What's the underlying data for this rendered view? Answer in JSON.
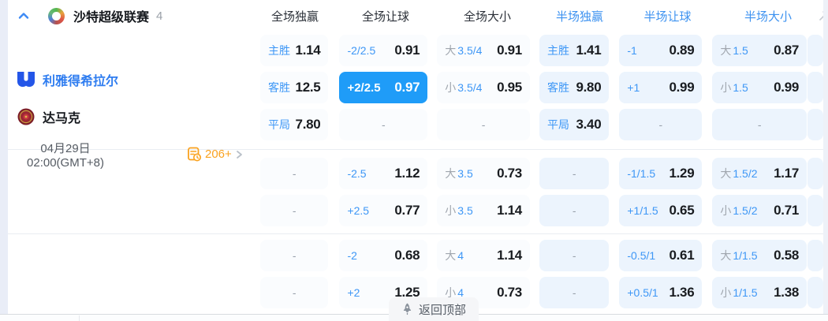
{
  "header": {
    "league_name": "沙特超级联赛",
    "league_count": "4",
    "columns": [
      {
        "label": "全场独赢",
        "half": false
      },
      {
        "label": "全场让球",
        "half": false
      },
      {
        "label": "全场大小",
        "half": false
      },
      {
        "label": "半场独赢",
        "half": true
      },
      {
        "label": "半场让球",
        "half": true
      },
      {
        "label": "半场大小",
        "half": true
      }
    ]
  },
  "match": {
    "home_name": "利雅得希拉尔",
    "away_name": "达马克",
    "date_line1": "04月29日",
    "date_line2": "02:00(GMT+8)",
    "stats_count": "206+"
  },
  "odds": {
    "groups": [
      [
        [
          {
            "line": "主胜",
            "value": "1.14"
          },
          {
            "line": "-2/2.5",
            "value": "0.91"
          },
          {
            "prefix": "大",
            "line": "3.5/4",
            "value": "0.91"
          },
          {
            "line": "主胜",
            "value": "1.41"
          },
          {
            "line": "-1",
            "value": "0.89"
          },
          {
            "prefix": "大",
            "line": "1.5",
            "value": "0.87"
          }
        ],
        [
          {
            "line": "客胜",
            "value": "12.5"
          },
          {
            "line": "+2/2.5",
            "value": "0.97",
            "highlight": true
          },
          {
            "prefix": "小",
            "line": "3.5/4",
            "value": "0.95"
          },
          {
            "line": "客胜",
            "value": "9.80"
          },
          {
            "line": "+1",
            "value": "0.99"
          },
          {
            "prefix": "小",
            "line": "1.5",
            "value": "0.99"
          }
        ],
        [
          {
            "line": "平局",
            "value": "7.80"
          },
          {
            "dash": true
          },
          {
            "dash": true
          },
          {
            "line": "平局",
            "value": "3.40"
          },
          {
            "dash": true
          },
          {
            "dash": true
          }
        ]
      ],
      [
        [
          {
            "dash": true
          },
          {
            "line": "-2.5",
            "value": "1.12"
          },
          {
            "prefix": "大",
            "line": "3.5",
            "value": "0.73"
          },
          {
            "dash": true
          },
          {
            "line": "-1/1.5",
            "value": "1.29"
          },
          {
            "prefix": "大",
            "line": "1.5/2",
            "value": "1.17"
          }
        ],
        [
          {
            "dash": true
          },
          {
            "line": "+2.5",
            "value": "0.77"
          },
          {
            "prefix": "小",
            "line": "3.5",
            "value": "1.14"
          },
          {
            "dash": true
          },
          {
            "line": "+1/1.5",
            "value": "0.65"
          },
          {
            "prefix": "小",
            "line": "1.5/2",
            "value": "0.71"
          }
        ]
      ],
      [
        [
          {
            "dash": true
          },
          {
            "line": "-2",
            "value": "0.68"
          },
          {
            "prefix": "大",
            "line": "4",
            "value": "1.14"
          },
          {
            "dash": true
          },
          {
            "line": "-0.5/1",
            "value": "0.61"
          },
          {
            "prefix": "大",
            "line": "1/1.5",
            "value": "0.58"
          }
        ],
        [
          {
            "dash": true
          },
          {
            "line": "+2",
            "value": "1.25"
          },
          {
            "prefix": "小",
            "line": "4",
            "value": "0.73"
          },
          {
            "dash": true
          },
          {
            "line": "+0.5/1",
            "value": "1.36"
          },
          {
            "prefix": "小",
            "line": "1/1.5",
            "value": "1.38"
          }
        ]
      ]
    ]
  },
  "footer": {
    "back_to_top": "返回顶部"
  },
  "colors": {
    "highlight_cell": "#1f9cf8",
    "label_blue": "#3e97f6",
    "header_half_blue": "#3d92f0",
    "half_cell_bg": "#ecf4fd",
    "full_cell_bg": "#fafcfe",
    "stats_orange": "#faa21f",
    "home_team_blue": "#2f7df0"
  }
}
